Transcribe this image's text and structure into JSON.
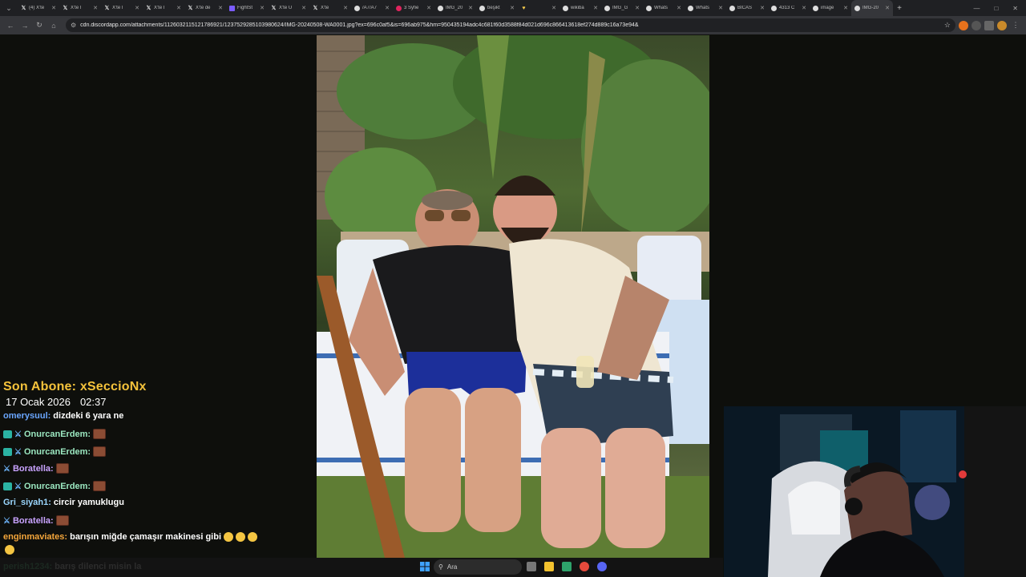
{
  "browser": {
    "tabs": [
      {
        "title": "(4) X'te",
        "icon": "x-logo-icon"
      },
      {
        "title": "X'te İ",
        "icon": "x-logo-icon"
      },
      {
        "title": "X'te İ",
        "icon": "x-logo-icon"
      },
      {
        "title": "X'te İ",
        "icon": "x-logo-icon"
      },
      {
        "title": "X'te de",
        "icon": "x-logo-icon"
      },
      {
        "title": "FightSt",
        "icon": "feather-icon"
      },
      {
        "title": "X'te Ü",
        "icon": "x-logo-icon"
      },
      {
        "title": "X'te",
        "icon": "x-logo-icon"
      },
      {
        "title": "/A7/A7",
        "icon": "globe-icon"
      },
      {
        "title": "3 Syfie",
        "icon": "red-dot-icon"
      },
      {
        "title": "IMG_20",
        "icon": "globe-icon"
      },
      {
        "title": "beşikt",
        "icon": "globe-icon"
      },
      {
        "title": "",
        "icon": "hearts-icon"
      },
      {
        "title": "wikiba",
        "icon": "globe-icon"
      },
      {
        "title": "IMG_G",
        "icon": "globe-icon"
      },
      {
        "title": "Whats",
        "icon": "globe-icon"
      },
      {
        "title": "Whats",
        "icon": "globe-icon"
      },
      {
        "title": "BICAS",
        "icon": "globe-icon"
      },
      {
        "title": "4313 C",
        "icon": "globe-icon"
      },
      {
        "title": "image",
        "icon": "globe-icon"
      },
      {
        "title": "IMG-20",
        "icon": "globe-icon",
        "active": true
      }
    ],
    "url": "cdn.discordapp.com/attachments/1126032115121786921/1237529285103980624/IMG-20240508-WA0001.jpg?ex=696c0af5&is=696ab975&hm=950435194adc4c681f60d3588f84d021d696c866413618ef274d889c16a73e94&"
  },
  "overlay": {
    "last_sub": "Son Abone: xSeccioNx",
    "date": "17 Ocak 2026",
    "time": "02:37"
  },
  "chat": [
    {
      "user": "omerysuul:",
      "text": "dizdeki 6 yara ne",
      "color": "#6aa6ff",
      "badges": []
    },
    {
      "user": "OnurcanErdem:",
      "text": "",
      "color": "#9be7c0",
      "badges": [
        "sub",
        "sword"
      ],
      "emote": "brick"
    },
    {
      "user": "OnurcanErdem:",
      "text": "",
      "color": "#9be7c0",
      "badges": [
        "sub",
        "sword"
      ],
      "emote": "brick"
    },
    {
      "user": "Boratella:",
      "text": "",
      "color": "#c9a3ff",
      "badges": [
        "sword"
      ],
      "emote": "brick"
    },
    {
      "user": "OnurcanErdem:",
      "text": "",
      "color": "#9be7c0",
      "badges": [
        "sub",
        "sword"
      ],
      "emote": "brick"
    },
    {
      "user": "Gri_siyah1:",
      "text": "circir yamuklugu",
      "color": "#9bd7ff",
      "badges": []
    },
    {
      "user": "Boratella:",
      "text": "",
      "color": "#c9a3ff",
      "badges": [
        "sword"
      ],
      "emote": "brick"
    },
    {
      "user": "enginmaviates:",
      "text": "barışın miğde çamaşır makinesi gibi",
      "color": "#f4a63b",
      "badges": [],
      "emote": "laugh"
    },
    {
      "user": "perish1234:",
      "text": "barış dilenci misin la",
      "color": "#5ee08a",
      "badges": []
    }
  ],
  "taskbar": {
    "search_placeholder": "Ara"
  },
  "colors": {
    "sub_banner": "#f4c23b",
    "tab_bg": "#1f2023",
    "toolbar_bg": "#35363a"
  }
}
